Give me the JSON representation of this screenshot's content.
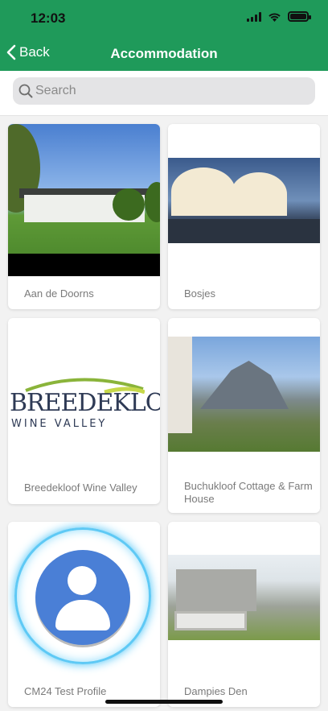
{
  "status_bar": {
    "time": "12:03"
  },
  "nav": {
    "back_label": "Back",
    "title": "Accommodation"
  },
  "search": {
    "placeholder": "Search",
    "value": ""
  },
  "cards": [
    {
      "label": "Aan de Doorns"
    },
    {
      "label": "Bosjes"
    },
    {
      "label": "Breedekloof Wine Valley",
      "logo_main": "BREEDEKLOOF",
      "logo_sub": "WINE VALLEY"
    },
    {
      "label": "Buchukloof Cottage & Farm House"
    },
    {
      "label": "CM24 Test Profile"
    },
    {
      "label": "Dampies Den"
    }
  ],
  "colors": {
    "accent": "#1f9a5a"
  }
}
